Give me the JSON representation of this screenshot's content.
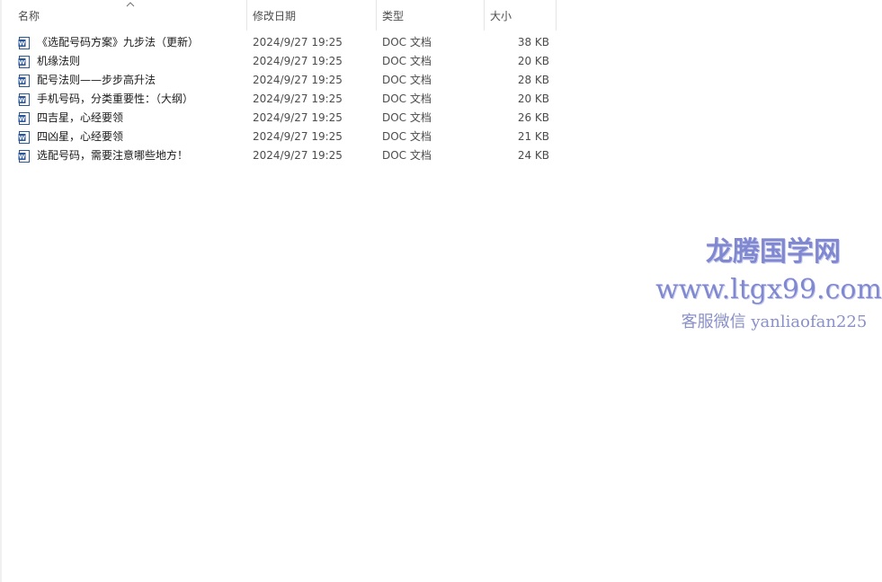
{
  "columns": {
    "name": "名称",
    "date": "修改日期",
    "type": "类型",
    "size": "大小"
  },
  "files": [
    {
      "name": "《选配号码方案》九步法（更新）",
      "date": "2024/9/27 19:25",
      "type": "DOC 文档",
      "size": "38 KB"
    },
    {
      "name": "机缘法则",
      "date": "2024/9/27 19:25",
      "type": "DOC 文档",
      "size": "20 KB"
    },
    {
      "name": "配号法则——步步高升法",
      "date": "2024/9/27 19:25",
      "type": "DOC 文档",
      "size": "28 KB"
    },
    {
      "name": "手机号码，分类重要性：（大纲）",
      "date": "2024/9/27 19:25",
      "type": "DOC 文档",
      "size": "20 KB"
    },
    {
      "name": "四吉星，心经要领",
      "date": "2024/9/27 19:25",
      "type": "DOC 文档",
      "size": "26 KB"
    },
    {
      "name": "四凶星，心经要领",
      "date": "2024/9/27 19:25",
      "type": "DOC 文档",
      "size": "21 KB"
    },
    {
      "name": "选配号码，需要注意哪些地方！",
      "date": "2024/9/27 19:25",
      "type": "DOC 文档",
      "size": "24 KB"
    }
  ],
  "watermark": {
    "title": "龙腾国学网",
    "url": "www.ltgx99.com",
    "contact": "客服微信 yanliaofan225"
  },
  "icons": {
    "file": "word-doc-icon",
    "sort": "sort-up-icon"
  },
  "colors": {
    "doc_icon": "#2b579a",
    "watermark": "#8088d0"
  }
}
